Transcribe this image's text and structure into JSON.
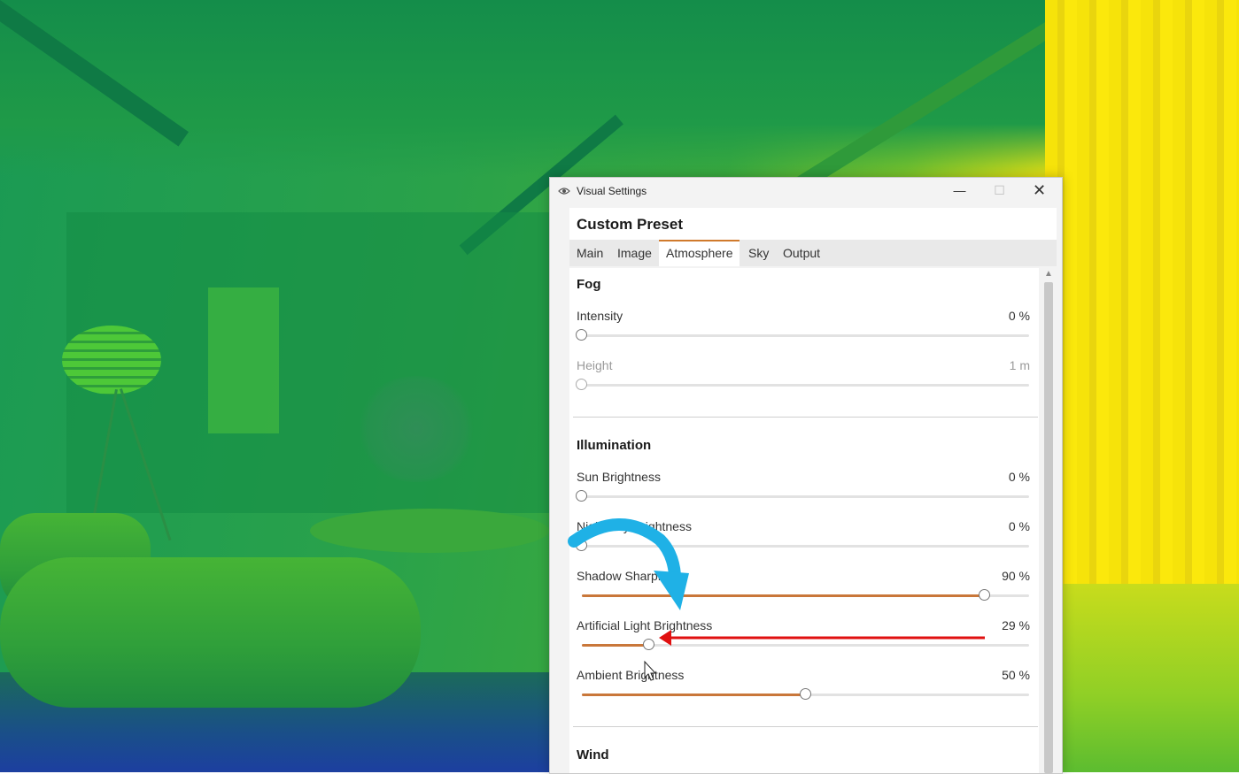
{
  "window": {
    "title": "Visual Settings",
    "minimize_glyph": "—",
    "maximize_glyph": "☐",
    "close_glyph": "✕"
  },
  "preset": {
    "title": "Custom Preset"
  },
  "tabs": [
    {
      "label": "Main",
      "active": false
    },
    {
      "label": "Image",
      "active": false
    },
    {
      "label": "Atmosphere",
      "active": true
    },
    {
      "label": "Sky",
      "active": false
    },
    {
      "label": "Output",
      "active": false
    }
  ],
  "sections": {
    "fog": {
      "title": "Fog",
      "intensity": {
        "label": "Intensity",
        "value": "0 %",
        "percent": 0
      },
      "height": {
        "label": "Height",
        "value": "1 m",
        "percent": 0,
        "disabled": true
      }
    },
    "illumination": {
      "title": "Illumination",
      "sun": {
        "label": "Sun Brightness",
        "value": "0 %",
        "percent": 0
      },
      "night_sky": {
        "label": "Night Sky Brightness",
        "value": "0 %",
        "percent": 0
      },
      "shadow": {
        "label": "Shadow Sharpness",
        "value": "90 %",
        "percent": 90
      },
      "artificial": {
        "label": "Artificial Light Brightness",
        "value": "29 %",
        "percent": 15
      },
      "ambient": {
        "label": "Ambient Brightness",
        "value": "50 %",
        "percent": 50
      }
    },
    "wind": {
      "title": "Wind"
    }
  },
  "side_chevron": "‹",
  "icons": [
    "eye-settings-icon",
    "chevron-left-icon",
    "scroll-up-icon",
    "cursor-icon"
  ],
  "colors": {
    "accent": "#c9773a",
    "annotation_arrow_blue": "#1fb1e6",
    "annotation_arrow_red": "#e01010"
  }
}
